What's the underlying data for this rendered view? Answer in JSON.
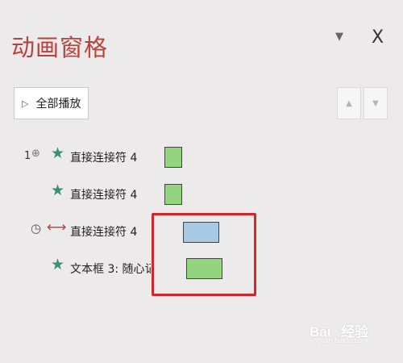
{
  "pane": {
    "title": "动画窗格",
    "menu_icon": "dropdown-triangle-icon",
    "close_glyph": "X"
  },
  "toolbar": {
    "play_all_label": "全部播放",
    "move_up_icon": "triangle-up-icon",
    "move_down_icon": "triangle-down-icon"
  },
  "animations": [
    {
      "order": "1",
      "trigger": "on-click",
      "effect": "entrance-star",
      "name": "直接连接符 4",
      "bar_color": "#93d47e"
    },
    {
      "order": "",
      "trigger": "with-previous",
      "effect": "entrance-star",
      "name": "直接连接符 4",
      "bar_color": "#93d47e"
    },
    {
      "order": "",
      "trigger": "after-previous",
      "effect": "motion-path",
      "name": "直接连接符 4",
      "bar_color": "#a8c8e3"
    },
    {
      "order": "",
      "trigger": "with-previous",
      "effect": "entrance-star",
      "name": "文本框 3: 随心记",
      "bar_color": "#93d47e"
    }
  ],
  "highlight_color": "#d6252a",
  "watermark": {
    "text": "Bai♁经验",
    "sub": "jingyan.baidu.com"
  }
}
